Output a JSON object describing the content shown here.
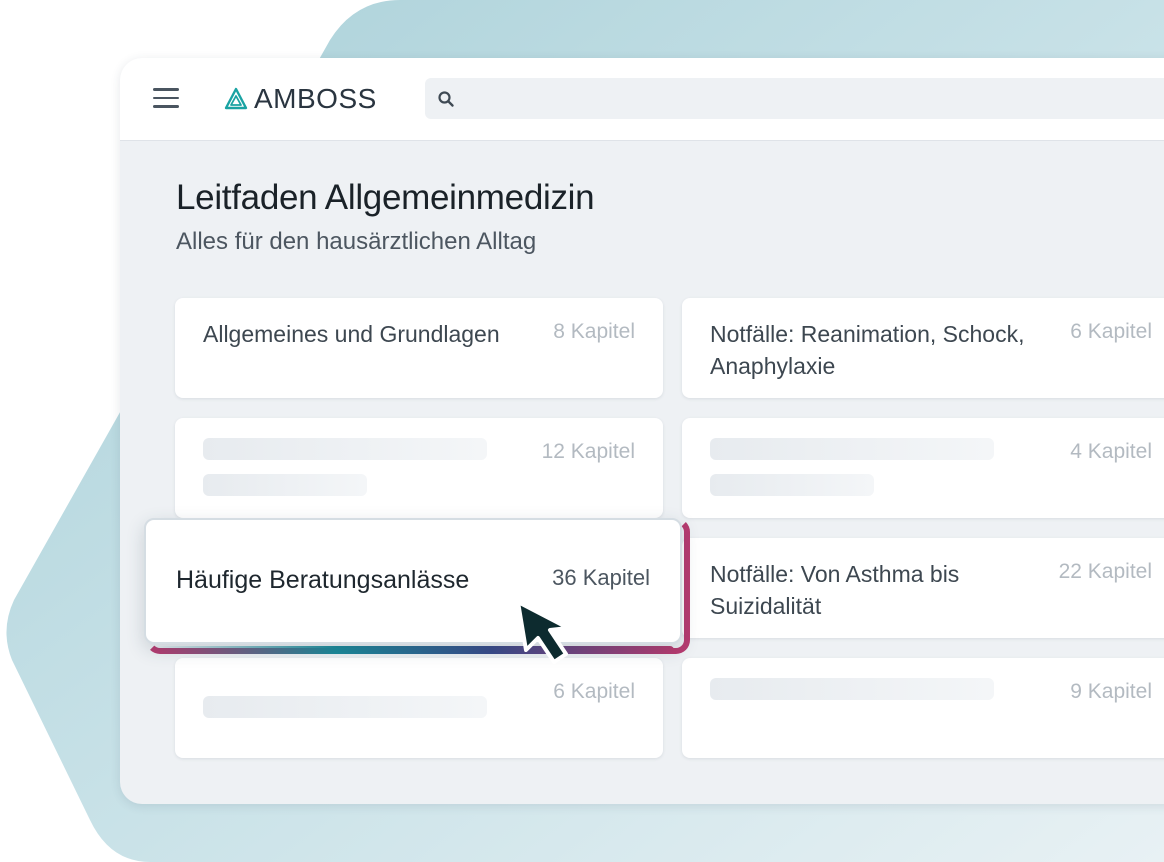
{
  "app": {
    "brand": "AMBOSS"
  },
  "header": {
    "search_placeholder": ""
  },
  "page": {
    "title": "Leitfaden Allgemeinmedizin",
    "subtitle": "Alles für den hausärztlichen Alltag"
  },
  "cards": {
    "c1": {
      "title": "Allgemeines und Grundlagen",
      "count": "8 Kapitel"
    },
    "c2": {
      "title": "Notfälle: Reanimation, Schock, Anaphylaxie",
      "count": "6 Kapitel"
    },
    "c3": {
      "title": "",
      "count": "12 Kapitel"
    },
    "c4": {
      "title": "",
      "count": "4 Kapitel"
    },
    "c5": {
      "title": "Häufige Beratungsanlässe",
      "count": "36 Kapitel"
    },
    "c6": {
      "title": "Notfälle: Von Asthma bis Suizidalität",
      "count": "22 Kapitel"
    },
    "c7": {
      "title": "",
      "count": "6 Kapitel"
    },
    "c8": {
      "title": "",
      "count": "9 Kapitel"
    }
  },
  "colors": {
    "brand_teal": "#1aa3a3",
    "highlight_pink": "#b73b70",
    "cursor_dark": "#0d2b2f"
  },
  "icons": [
    "menu-icon",
    "amboss-logo-icon",
    "search-icon",
    "cursor-icon"
  ]
}
